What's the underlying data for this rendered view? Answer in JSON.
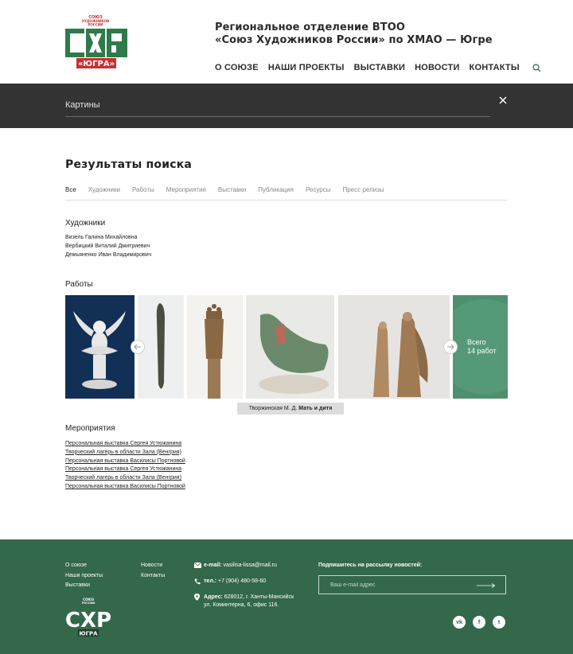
{
  "header": {
    "logo_text": {
      "top": "СОЮЗ ХУДОЖНИКОВ РОССИИ",
      "main": "СХР",
      "sub": "ЮГРА"
    },
    "org_title_line1": "Региональное отделение ВТОО",
    "org_title_line2": "«Союз Художников России» по ХМАО — Югре",
    "nav": [
      "О СОЮЗЕ",
      "НАШИ ПРОЕКТЫ",
      "ВЫСТАВКИ",
      "НОВОСТИ",
      "КОНТАКТЫ"
    ]
  },
  "search": {
    "value": "Картины"
  },
  "results": {
    "title": "Результаты поиска",
    "tabs": [
      "Все",
      "Художники",
      "Работы",
      "Мероприятия",
      "Выставки",
      "Публикация",
      "Ресурсы",
      "Пресс релизы"
    ],
    "artists_title": "Художники",
    "artists": [
      "Визель Галина Михайловна",
      "Вербицкий Виталий Дмитриевич",
      "Демьяненко Иван Владимирович"
    ],
    "works_title": "Работы",
    "works_caption_author": "Творжинская М. Д.",
    "works_caption_title": "Мать и дитя",
    "works_total_line1": "Всего",
    "works_total_line2": "14 работ",
    "events_title": "Мероприятия",
    "events": [
      "Персональная выставка Сергея Устюжанина",
      "Творческий лагерь в области Зала (Венгрия)",
      "Персональная выставка Василисы Портновой",
      "Персональная выставка Сергея Устюжанина",
      "Творческий лагерь в области Зала (Венгрия)",
      "Персональная выставка Василисы Портновой"
    ]
  },
  "footer": {
    "col1": [
      "О союзе",
      "Наши проекты",
      "Выставки"
    ],
    "col2": [
      "Новости",
      "Контакты"
    ],
    "email_label": "e-mail:",
    "email_value": "vasilisa-lissa@mail.ru",
    "phone_label": "тел.:",
    "phone_value": "+7 (904) 480-58-60",
    "address_label": "Адрес:",
    "address_line1": "628012, г. Ханты-Мансийск",
    "address_line2": "ул. Коминтерна, 6, офис 116.",
    "subscribe_title": "Подпишитесь на рассылку новостей:",
    "subscribe_placeholder": "Ваш e-mail адрес",
    "social": [
      "vk-icon",
      "facebook-icon",
      "twitter-icon"
    ],
    "social_labels": {
      "vk": "vk",
      "facebook": "f",
      "twitter": "t"
    }
  },
  "colors": {
    "brand_green": "#33684a",
    "logo_red": "#c8302d",
    "logo_green": "#2e7a4a",
    "search_bg": "#333333"
  }
}
